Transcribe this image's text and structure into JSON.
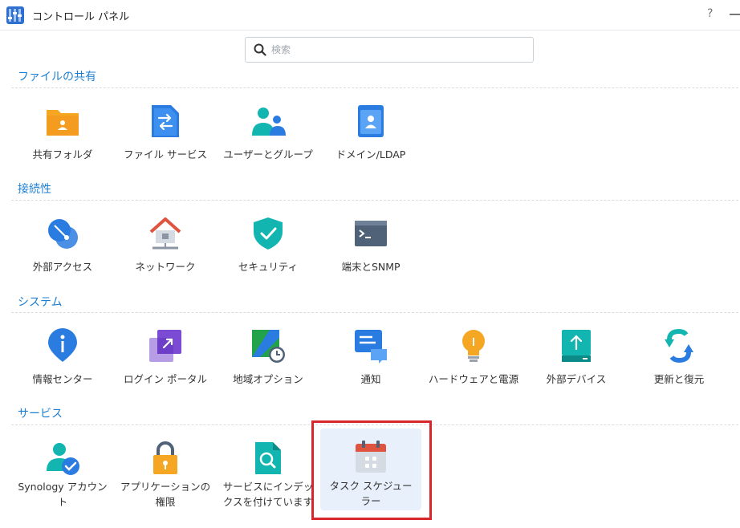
{
  "window": {
    "title": "コントロール パネル",
    "help_label": "?"
  },
  "search": {
    "placeholder": "検索",
    "value": ""
  },
  "sections": [
    {
      "title": "ファイルの共有",
      "items": [
        {
          "label": "共有フォルダ",
          "icon": "shared-folder-icon"
        },
        {
          "label": "ファイル サービス",
          "icon": "file-services-icon"
        },
        {
          "label": "ユーザーとグループ",
          "icon": "users-groups-icon"
        },
        {
          "label": "ドメイン/LDAP",
          "icon": "domain-ldap-icon"
        }
      ]
    },
    {
      "title": "接続性",
      "items": [
        {
          "label": "外部アクセス",
          "icon": "external-access-icon"
        },
        {
          "label": "ネットワーク",
          "icon": "network-icon"
        },
        {
          "label": "セキュリティ",
          "icon": "security-shield-icon"
        },
        {
          "label": "端末とSNMP",
          "icon": "terminal-icon"
        }
      ]
    },
    {
      "title": "システム",
      "items": [
        {
          "label": "情報センター",
          "icon": "info-center-icon"
        },
        {
          "label": "ログイン ポータル",
          "icon": "login-portal-icon"
        },
        {
          "label": "地域オプション",
          "icon": "regional-options-icon"
        },
        {
          "label": "通知",
          "icon": "notification-icon"
        },
        {
          "label": "ハードウェアと電源",
          "icon": "hardware-power-icon"
        },
        {
          "label": "外部デバイス",
          "icon": "external-devices-icon"
        },
        {
          "label": "更新と復元",
          "icon": "update-restore-icon"
        }
      ]
    },
    {
      "title": "サービス",
      "items": [
        {
          "label_line1": "Synology アカウン",
          "label_line2": "ト",
          "icon": "synology-account-icon"
        },
        {
          "label_line1": "アプリケーションの",
          "label_line2": "権限",
          "icon": "app-privileges-icon"
        },
        {
          "label_line1": "サービスにインデッ",
          "label_line2": "クスを付けています",
          "icon": "indexing-service-icon"
        },
        {
          "label_line1": "タスク スケジュー",
          "label_line2": "ラー",
          "icon": "task-scheduler-icon",
          "selected": true
        }
      ]
    }
  ],
  "colors": {
    "section_title": "#1d7fd1",
    "highlight_border": "#d7262c",
    "selected_bg": "#e8f1fb"
  }
}
